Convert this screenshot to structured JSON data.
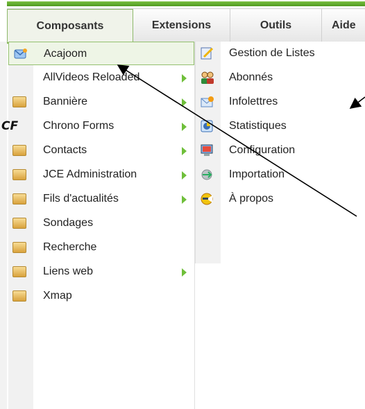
{
  "menubar": {
    "items": [
      {
        "label": "Composants",
        "active": true
      },
      {
        "label": "Extensions",
        "active": false
      },
      {
        "label": "Outils",
        "active": false
      },
      {
        "label": "Aide",
        "active": false
      }
    ]
  },
  "menu": {
    "items": [
      {
        "label": "Acajoom",
        "icon": "acajoom-icon",
        "has_submenu": false
      },
      {
        "label": "AllVideos Reloaded",
        "icon": "",
        "has_submenu": true
      },
      {
        "label": "Bannière",
        "icon": "folder-icon",
        "has_submenu": true
      },
      {
        "label": "Chrono Forms",
        "icon": "chrono-forms-icon",
        "has_submenu": true
      },
      {
        "label": "Contacts",
        "icon": "folder-icon",
        "has_submenu": true
      },
      {
        "label": "JCE Administration",
        "icon": "folder-icon",
        "has_submenu": true
      },
      {
        "label": "Fils d'actualités",
        "icon": "folder-icon",
        "has_submenu": true
      },
      {
        "label": "Sondages",
        "icon": "folder-icon",
        "has_submenu": false
      },
      {
        "label": "Recherche",
        "icon": "folder-icon",
        "has_submenu": false
      },
      {
        "label": "Liens web",
        "icon": "folder-icon",
        "has_submenu": true
      },
      {
        "label": "Xmap",
        "icon": "folder-icon",
        "has_submenu": false
      }
    ],
    "chrono_icon_text": "CF"
  },
  "submenu": {
    "items": [
      {
        "label": "Gestion de Listes",
        "icon": "lists-icon"
      },
      {
        "label": "Abonnés",
        "icon": "subscribers-icon"
      },
      {
        "label": "Infolettres",
        "icon": "newsletters-icon"
      },
      {
        "label": "Statistiques",
        "icon": "statistics-icon"
      },
      {
        "label": "Configuration",
        "icon": "configuration-icon"
      },
      {
        "label": "Importation",
        "icon": "import-icon"
      },
      {
        "label": "À propos",
        "icon": "about-icon"
      }
    ]
  },
  "colors": {
    "accent_green": "#6fbf3a",
    "highlight_bg": "#eef5e6",
    "folder": "#e6b655"
  }
}
